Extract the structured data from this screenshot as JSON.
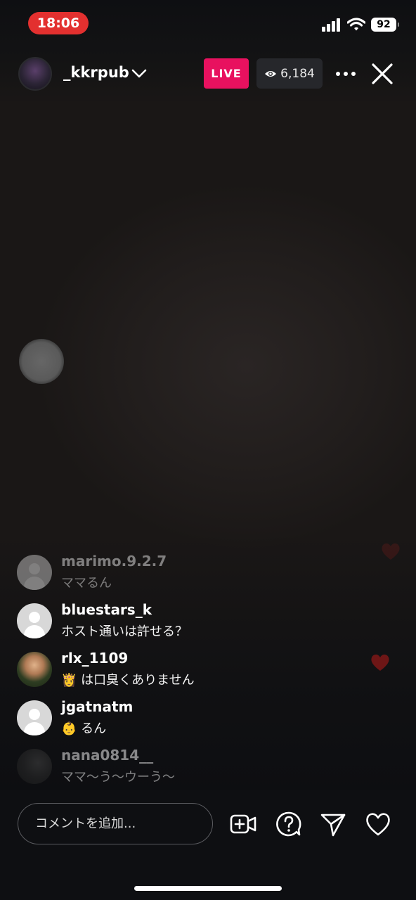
{
  "status_bar": {
    "time": "18:06",
    "battery": "92",
    "icons": [
      "signal-icon",
      "wifi-icon",
      "battery-icon"
    ]
  },
  "header": {
    "username": "_kkrpub",
    "live_label": "LIVE",
    "viewer_count": "6,184",
    "icons": [
      "chevron-down-icon",
      "eye-icon",
      "more-icon",
      "close-icon"
    ]
  },
  "comments": [
    {
      "username": "marimo.9.2.7",
      "text": "ママるん"
    },
    {
      "username": "bluestars_k",
      "text": "ホスト通いは許せる？"
    },
    {
      "username": "rlx_1109",
      "emoji": "👸",
      "text": "は口臭くありません"
    },
    {
      "username": "jgatnatm",
      "emoji": "👶",
      "text": "るん"
    },
    {
      "username": "nana0814__",
      "text": "ママ〜う〜ウーう〜"
    }
  ],
  "comment_box": {
    "placeholder": "コメントを追加..."
  },
  "colors": {
    "live_badge": "#e8115f",
    "status_time_bg": "#e3302f",
    "heart": "#8a1c1c"
  }
}
